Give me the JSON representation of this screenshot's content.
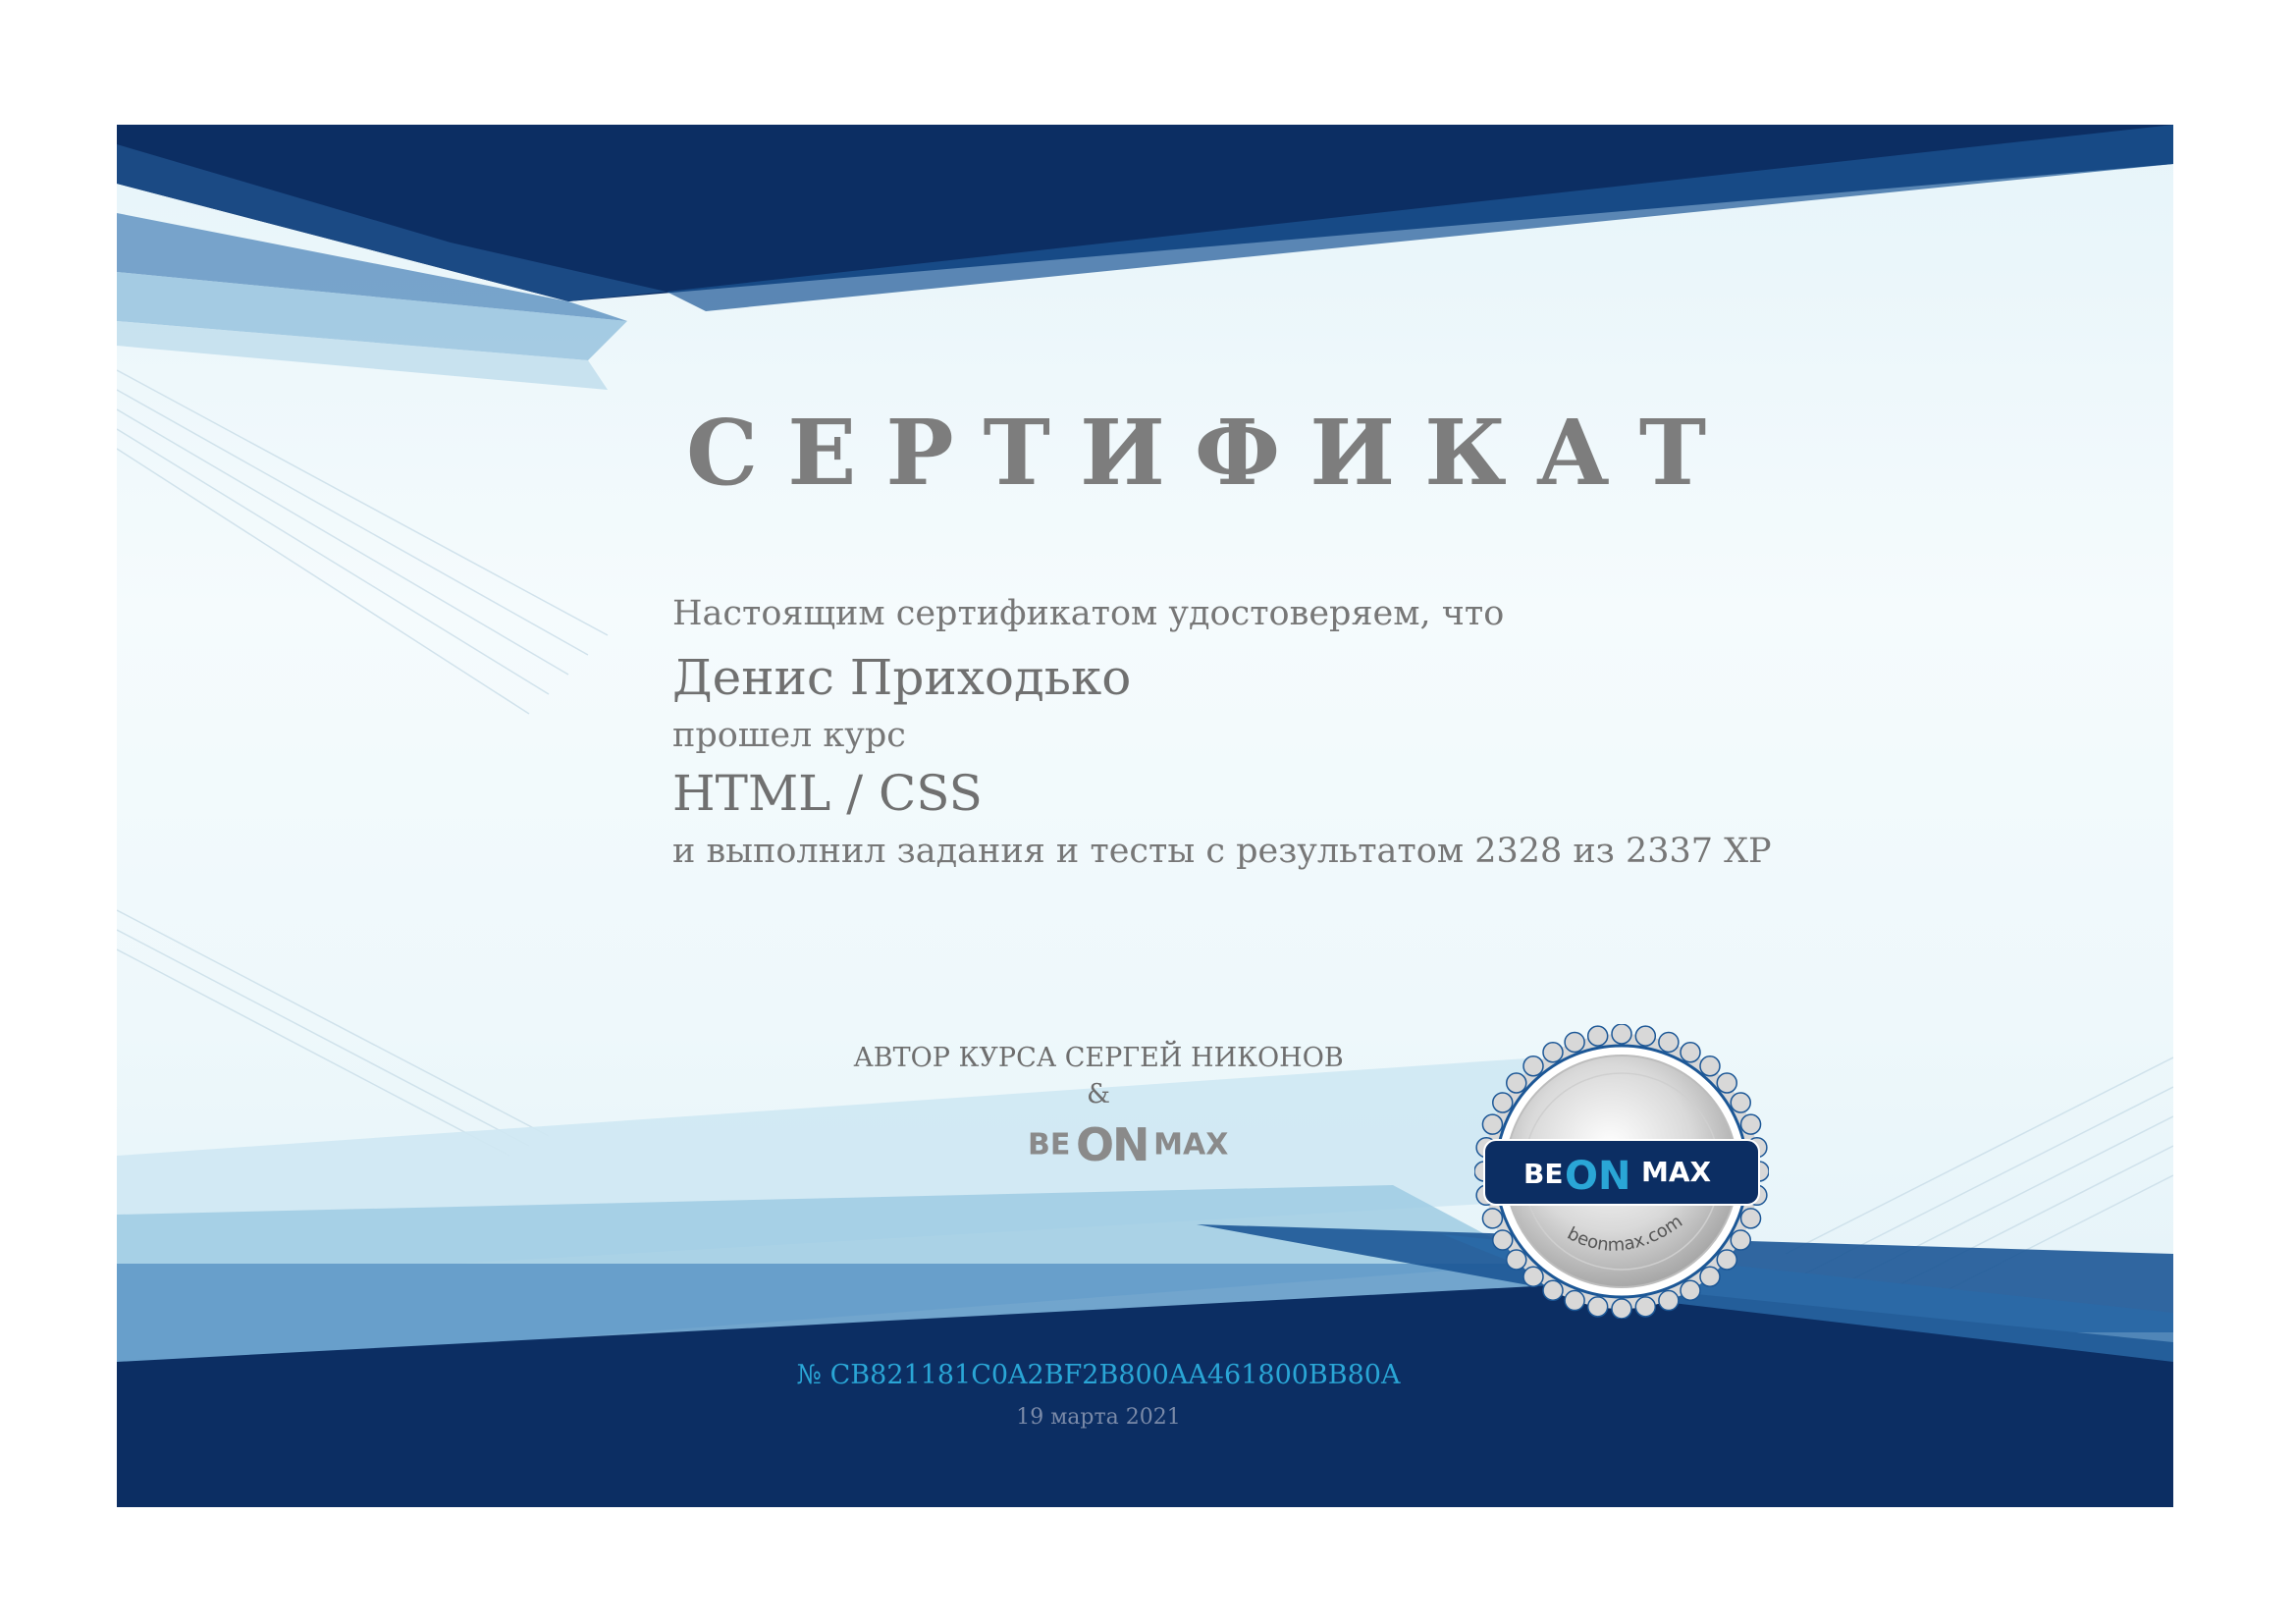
{
  "certificate": {
    "title": "СЕРТИФИКАТ",
    "intro": "Настоящим сертификатом удостоверяем, что",
    "recipient": "Денис Приходько",
    "passed": "прошел курс",
    "course": "HTML / CSS",
    "result": "и выполнил задания и тесты с результатом 2328 из 2337 XP",
    "author": "АВТОР КУРСА СЕРГЕЙ НИКОНОВ",
    "ampersand": "&",
    "logo": {
      "be": "BE",
      "on": "ON",
      "max": "MAX"
    },
    "seal": {
      "be": "BE",
      "on": "ON",
      "max": "MAX",
      "url": "beonmax.com"
    },
    "number": "№ CB821181C0A2BF2B800AA461800BB80A",
    "date": "19 марта 2021"
  },
  "colors": {
    "navy": "#0c2e63",
    "mid_blue": "#1c5796",
    "light_blue": "#7fb5d6",
    "accent": "#2aa6d6",
    "title_gray": "#7d7d7d"
  }
}
